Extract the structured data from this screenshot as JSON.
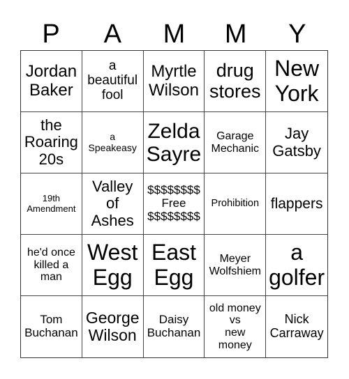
{
  "card": {
    "header_letters": [
      "P",
      "A",
      "M",
      "M",
      "Y"
    ],
    "cells": [
      {
        "text": "Jordan\nBaker",
        "size": "xl"
      },
      {
        "text": "a\nbeautiful\nfool",
        "size": "l"
      },
      {
        "text": "Myrtle\nWilson",
        "size": "xl"
      },
      {
        "text": "drug\nstores",
        "size": "xl"
      },
      {
        "text": "New\nYork",
        "size": "xxl"
      },
      {
        "text": "the\nRoaring\n20s",
        "size": "l"
      },
      {
        "text": "a\nSpeakeasy",
        "size": "s"
      },
      {
        "text": "Zelda\nSayre",
        "size": "xxl"
      },
      {
        "text": "Garage\nMechanic",
        "size": "m"
      },
      {
        "text": "Jay\nGatsby",
        "size": "l"
      },
      {
        "text": "19th\nAmendment",
        "size": "xs"
      },
      {
        "text": "Valley\nof\nAshes",
        "size": "l"
      },
      {
        "text": "$$$$$$$$\nFree\n$$$$$$$$",
        "size": "m"
      },
      {
        "text": "Prohibition",
        "size": "s"
      },
      {
        "text": "flappers",
        "size": "l"
      },
      {
        "text": "he'd once\nkilled a\nman",
        "size": "m"
      },
      {
        "text": "West\nEgg",
        "size": "xxl"
      },
      {
        "text": "East\nEgg",
        "size": "xxl"
      },
      {
        "text": "Meyer\nWolfshiem",
        "size": "m"
      },
      {
        "text": "a\ngolfer",
        "size": "xxl"
      },
      {
        "text": "Tom\nBuchanan",
        "size": "m"
      },
      {
        "text": "George\nWilson",
        "size": "l"
      },
      {
        "text": "Daisy\nBuchanan",
        "size": "m"
      },
      {
        "text": "old money\nvs\nnew\nmoney",
        "size": "m"
      },
      {
        "text": "Nick\nCarraway",
        "size": "m"
      }
    ]
  }
}
